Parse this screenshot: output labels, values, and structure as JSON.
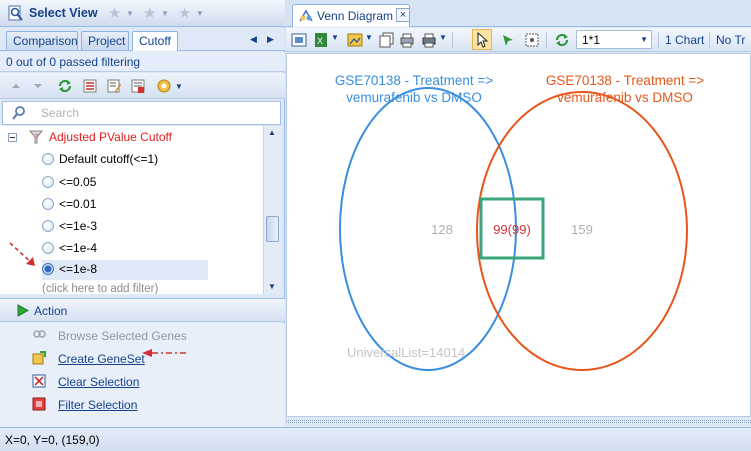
{
  "left_panel": {
    "select_view_label": "Select View",
    "tabs": [
      {
        "label": "Comparison",
        "active": false
      },
      {
        "label": "Project",
        "active": false
      },
      {
        "label": "Cutoff",
        "active": true
      }
    ],
    "filter_status": "0 out of 0 passed filtering",
    "search_placeholder": "Search",
    "tree": {
      "node_title": "Adjusted PValue Cutoff",
      "options": [
        {
          "label": "Default cutoff(<=1)",
          "selected": false
        },
        {
          "label": "<=0.05",
          "selected": false
        },
        {
          "label": "<=0.01",
          "selected": false
        },
        {
          "label": "<=1e-3",
          "selected": false
        },
        {
          "label": "<=1e-4",
          "selected": false
        },
        {
          "label": "<=1e-8",
          "selected": true
        }
      ],
      "add_filter_hint": "(click here to add filter)"
    },
    "action_section": {
      "title": "Action",
      "items": [
        {
          "label": "Browse Selected Genes",
          "enabled": false
        },
        {
          "label": "Create GeneSet",
          "enabled": true
        },
        {
          "label": "Clear Selection",
          "enabled": true
        },
        {
          "label": "Filter Selection",
          "enabled": true
        }
      ]
    }
  },
  "right_panel": {
    "tab_label": "Venn Diagram",
    "toolbar": {
      "layout_value": "1*1",
      "chart_count_label": "1 Chart",
      "truncated_label": "No Tr"
    },
    "venn": {
      "left_title_line1": "GSE70138 - Treatment =>",
      "left_title_line2": "vemurafenib vs DMSO",
      "right_title_line1": "GSE70138 - Treatment =>",
      "right_title_line2": "vemurafenib vs DMSO",
      "left_only_count": "128",
      "intersection_label": "99(99)",
      "right_only_count": "159",
      "universe_label": "UniversalList=14014",
      "left_color": "#3a8ee0",
      "right_color": "#e8561a",
      "intersection_color": "#d0333a",
      "highlight_color": "#3aa57a"
    }
  },
  "status_bar": {
    "text": "X=0, Y=0, (159,0)"
  }
}
